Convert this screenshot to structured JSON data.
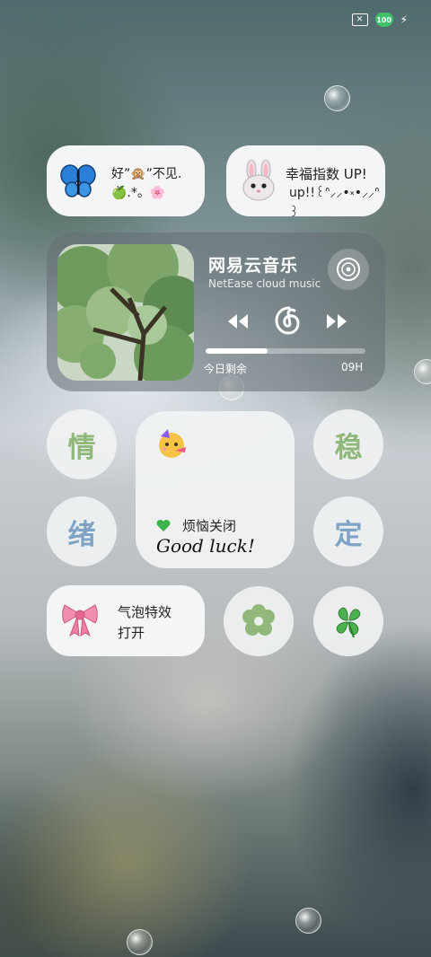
{
  "status": {
    "battery": "100"
  },
  "widgets": {
    "butterfly_text_line1": "好”🙊”不见.",
    "butterfly_text_line2": "🍏.*。🌸",
    "happy_line1": "幸福指数 UP!",
    "happy_line2": "up!!꒰ᐢ⸝⸝•༝•⸝⸝ᐢ꒱"
  },
  "music": {
    "title": "网易云音乐",
    "subtitle": "NetEase cloud music",
    "progress_label": "今日剩余",
    "progress_value": "09H",
    "progress_fraction": 0.39
  },
  "buttons": {
    "qing": "情",
    "xu": "绪",
    "wen": "稳",
    "ding": "定"
  },
  "center": {
    "line1": "烦恼关闭",
    "line2": "Good luck!"
  },
  "bubble_toggle": {
    "line1": "气泡特效",
    "line2": "打开"
  },
  "colors": {
    "green": "#8fb87a",
    "blue": "#7fa3c4"
  }
}
